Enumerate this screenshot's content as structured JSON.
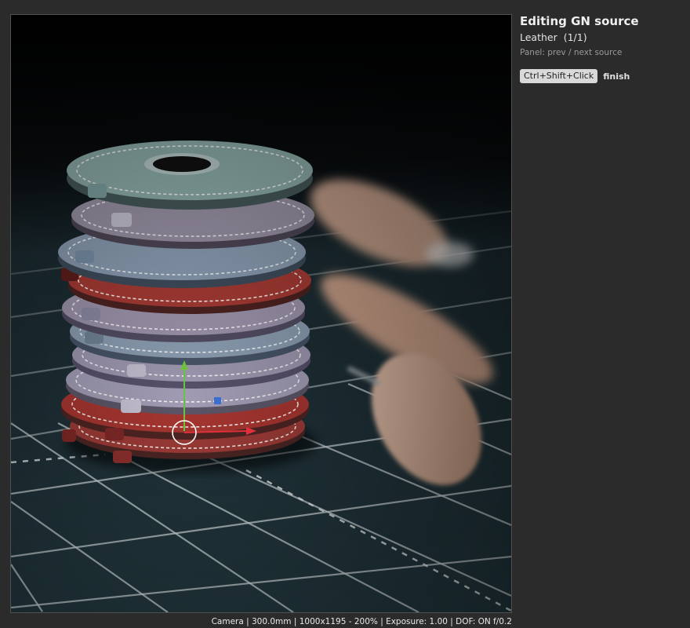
{
  "panel": {
    "title": "Editing GN source",
    "subtitle": "Leather  (1/1)",
    "hint": "Panel: prev / next source",
    "shortcut_key": "Ctrl+Shift+Click",
    "shortcut_action": "finish"
  },
  "status_bar": {
    "text": "Camera | 300.0mm | 1000x1195 - 200% | Exposure: 1.00 | DOF: ON f/0.2"
  },
  "viewport": {
    "scene": "leather-disc-stack-render",
    "gizmo_colors": {
      "x_axis": "#e0303c",
      "y_axis": "#6cc23c",
      "z_handle": "#3a6fd0"
    },
    "disc_colors": [
      "#8fb0ac",
      "#9a93a6",
      "#8b9db2",
      "#a63a34",
      "#9c93aa",
      "#8a9cb0",
      "#9c96ae",
      "#a19cb4",
      "#a53530",
      "#9a3a36"
    ]
  }
}
